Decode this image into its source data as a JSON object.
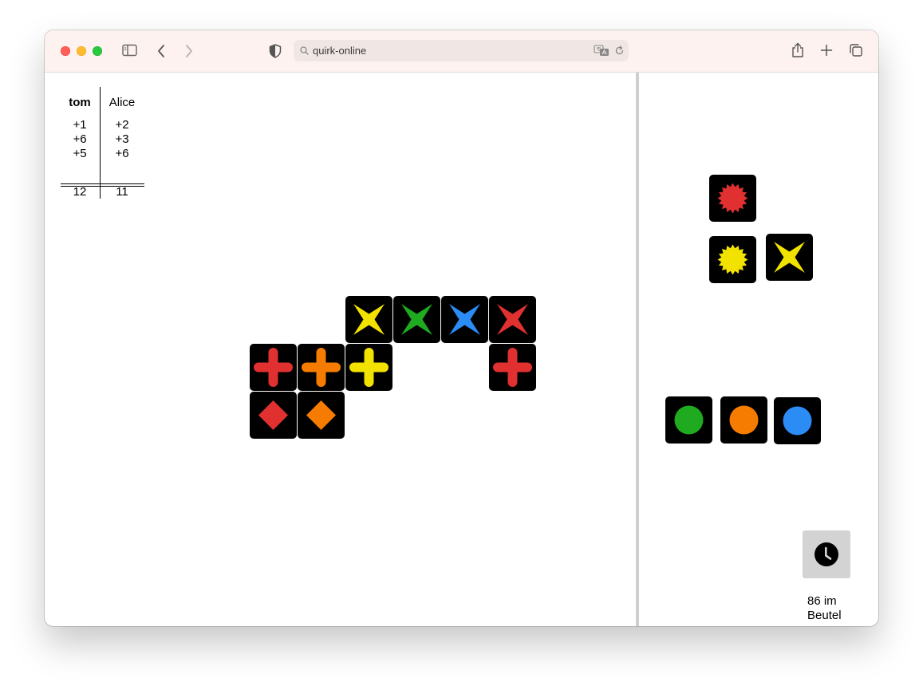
{
  "browser": {
    "url": "quirk-online"
  },
  "score": {
    "players": [
      "tom",
      "Alice"
    ],
    "tom": {
      "rounds": [
        "+1",
        "+6",
        "+5"
      ],
      "total": "12"
    },
    "alice": {
      "rounds": [
        "+2",
        "+3",
        "+6"
      ],
      "total": "11"
    }
  },
  "colors": {
    "red": "#e03030",
    "orange": "#f57c00",
    "yellow": "#f2e200",
    "green": "#1faa1f",
    "blue": "#2b8cf5",
    "tile_bg": "#000000"
  },
  "board": {
    "tiles": [
      {
        "shape": "star4",
        "color": "yellow",
        "col": 2,
        "row": 0
      },
      {
        "shape": "star4",
        "color": "green",
        "col": 3,
        "row": 0
      },
      {
        "shape": "star4",
        "color": "blue",
        "col": 4,
        "row": 0
      },
      {
        "shape": "star4",
        "color": "red",
        "col": 5,
        "row": 0
      },
      {
        "shape": "cross",
        "color": "red",
        "col": 0,
        "row": 1
      },
      {
        "shape": "cross",
        "color": "orange",
        "col": 1,
        "row": 1
      },
      {
        "shape": "cross",
        "color": "yellow",
        "col": 2,
        "row": 1
      },
      {
        "shape": "cross",
        "color": "red",
        "col": 5,
        "row": 1
      },
      {
        "shape": "diamond",
        "color": "red",
        "col": 0,
        "row": 2
      },
      {
        "shape": "diamond",
        "color": "orange",
        "col": 1,
        "row": 2
      }
    ]
  },
  "selection": {
    "tiles": [
      {
        "shape": "starburst",
        "color": "red"
      },
      {
        "shape": "starburst",
        "color": "yellow"
      },
      {
        "shape": "star4",
        "color": "yellow"
      }
    ]
  },
  "hand": {
    "tiles": [
      {
        "shape": "circle",
        "color": "green"
      },
      {
        "shape": "circle",
        "color": "orange"
      },
      {
        "shape": "circle",
        "color": "blue"
      }
    ]
  },
  "bag": {
    "icon": "clock-icon",
    "label": "86 im Beutel"
  }
}
